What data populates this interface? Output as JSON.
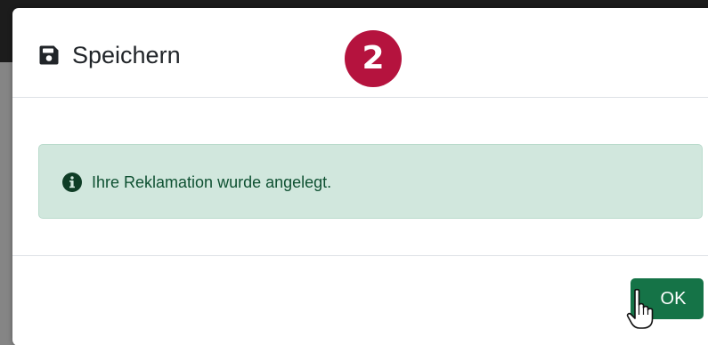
{
  "modal": {
    "title": "Speichern",
    "title_icon": "save-icon",
    "step_badge": "2",
    "alert": {
      "icon": "info-icon",
      "message": "Ihre Reklamation wurde angelegt."
    },
    "footer": {
      "ok_label": "OK"
    }
  },
  "colors": {
    "badge": "#b5133e",
    "alert_bg": "#d1e7dd",
    "alert_text": "#0f5132",
    "ok_button": "#157347"
  },
  "cursor": "hand-pointer-icon"
}
